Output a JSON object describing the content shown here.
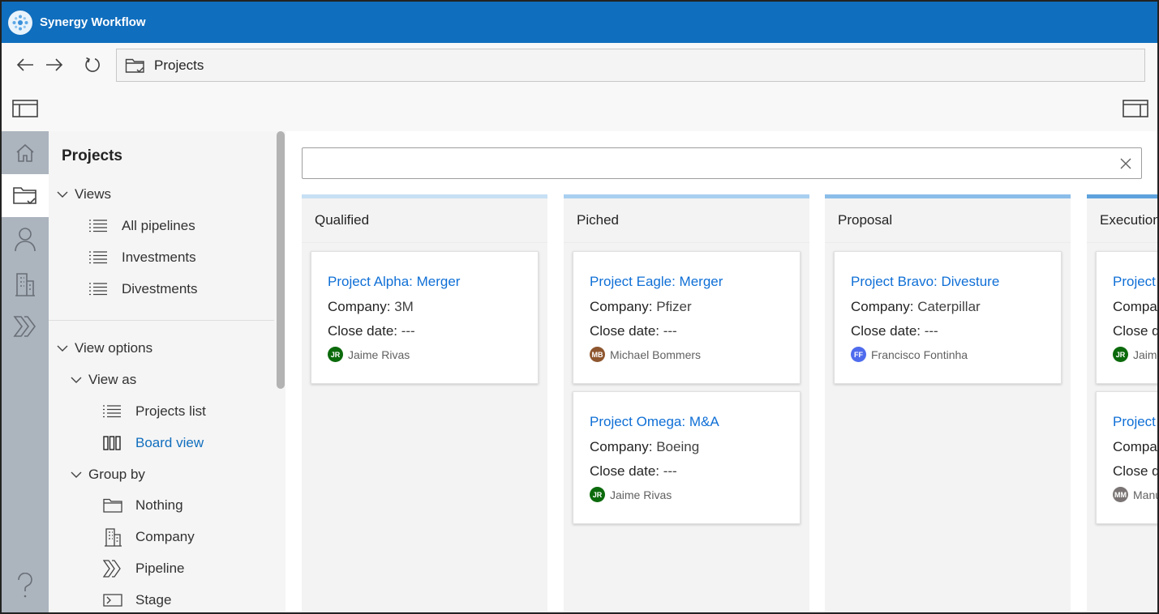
{
  "app": {
    "title": "Synergy Workflow"
  },
  "address": {
    "path": "Projects"
  },
  "sidepanel": {
    "title": "Projects",
    "views_label": "Views",
    "views": [
      "All pipelines",
      "Investments",
      "Divestments"
    ],
    "view_options_label": "View options",
    "view_as_label": "View as",
    "view_as": [
      {
        "label": "Projects list",
        "icon": "list-icon"
      },
      {
        "label": "Board view",
        "icon": "board-icon",
        "selected": true
      }
    ],
    "group_by_label": "Group by",
    "group_by": [
      {
        "label": "Nothing",
        "icon": "folder-icon"
      },
      {
        "label": "Company",
        "icon": "building-icon"
      },
      {
        "label": "Pipeline",
        "icon": "pipeline-icon"
      },
      {
        "label": "Stage",
        "icon": "stage-icon"
      }
    ]
  },
  "search": {
    "value": "",
    "placeholder": ""
  },
  "board": {
    "columns": [
      {
        "name": "Qualified",
        "cards": [
          {
            "title": "Project Alpha: Merger",
            "company_label": "Company:",
            "company": "3M",
            "close_label": "Close date:",
            "close": "---",
            "owner_initials": "JR",
            "owner": "Jaime Rivas"
          }
        ]
      },
      {
        "name": "Piched",
        "cards": [
          {
            "title": "Project Eagle: Merger",
            "company_label": "Company:",
            "company": "Pfizer",
            "close_label": "Close date:",
            "close": "---",
            "owner_initials": "MB",
            "owner": "Michael Bommers"
          },
          {
            "title": "Project Omega: M&A",
            "company_label": "Company:",
            "company": "Boeing",
            "close_label": "Close date:",
            "close": "---",
            "owner_initials": "JR",
            "owner": "Jaime Rivas"
          }
        ]
      },
      {
        "name": "Proposal",
        "cards": [
          {
            "title": "Project Bravo: Divesture",
            "company_label": "Company:",
            "company": "Caterpillar",
            "close_label": "Close date:",
            "close": "---",
            "owner_initials": "FF",
            "owner": "Francisco Fontinha"
          }
        ]
      },
      {
        "name": "Execution",
        "cards": [
          {
            "title": "Project",
            "company_label": "Compar",
            "close_label": "Close da",
            "owner_initials": "JR",
            "owner": "Jaime"
          },
          {
            "title": "Project",
            "company_label": "Compar",
            "close_label": "Close da",
            "owner_initials": "MM",
            "owner": "Manu"
          }
        ]
      }
    ]
  },
  "colors": {
    "titlebar": "#106ebe",
    "link": "#0f6fd6",
    "avatar_jr": "#0b6a0b",
    "avatar_mb": "#8e562e",
    "avatar_ff": "#4f6bed",
    "avatar_mm": "#7a7574",
    "column_bar_light": "#c7e0f4",
    "column_bar": "#8bbde9"
  }
}
